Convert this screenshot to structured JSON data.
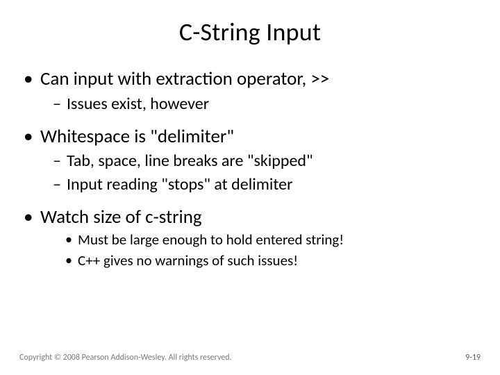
{
  "title": "C-String Input",
  "bullets": {
    "b1": "Can input with extraction operator, >>",
    "b1_1": "Issues exist, however",
    "b2": "Whitespace is \"delimiter\"",
    "b2_1": "Tab, space, line breaks are \"skipped\"",
    "b2_2": "Input reading \"stops\" at delimiter",
    "b3": "Watch size of c-string",
    "b3_1": "Must be large enough to hold entered string!",
    "b3_2": "C++ gives no warnings of such issues!"
  },
  "footer": {
    "copyright": "Copyright © 2008 Pearson Addison-Wesley. All rights reserved.",
    "page": "9-19"
  }
}
